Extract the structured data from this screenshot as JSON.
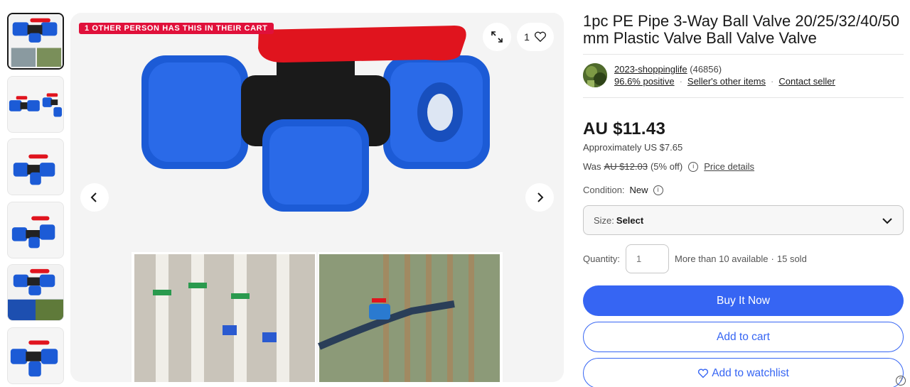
{
  "gallery": {
    "banner": "1 other person has this in their cart",
    "watch_count": "1",
    "thumb_count": 6
  },
  "listing": {
    "title": "1pc PE Pipe 3-Way Ball Valve 20/25/32/40/50 mm Plastic Valve Ball Valve Valve"
  },
  "seller": {
    "name": "2023-shoppinglife",
    "feedback_count": "(46856)",
    "positive": "96.6% positive",
    "other_items": "Seller's other items",
    "contact": "Contact seller"
  },
  "pricing": {
    "price": "AU $11.43",
    "approx": "Approximately US $7.65",
    "was_label": "Was",
    "was_price": "AU $12.03",
    "discount": "(5% off)",
    "details_link": "Price details"
  },
  "condition": {
    "label": "Condition:",
    "value": "New"
  },
  "size": {
    "label": "Size:",
    "value": "Select"
  },
  "quantity": {
    "label": "Quantity:",
    "placeholder": "1",
    "available": "More than 10 available",
    "sold": "15 sold"
  },
  "actions": {
    "buy_now": "Buy It Now",
    "add_cart": "Add to cart",
    "watchlist": "Add to watchlist"
  },
  "colors": {
    "accent": "#3665f3",
    "banner": "#e0103a",
    "valve_blue": "#1c5bd6",
    "handle_red": "#e0141e"
  },
  "icons": [
    "expand-icon",
    "heart-icon",
    "chevron-left-icon",
    "chevron-right-icon",
    "info-icon",
    "chevron-down-icon",
    "help-icon"
  ]
}
